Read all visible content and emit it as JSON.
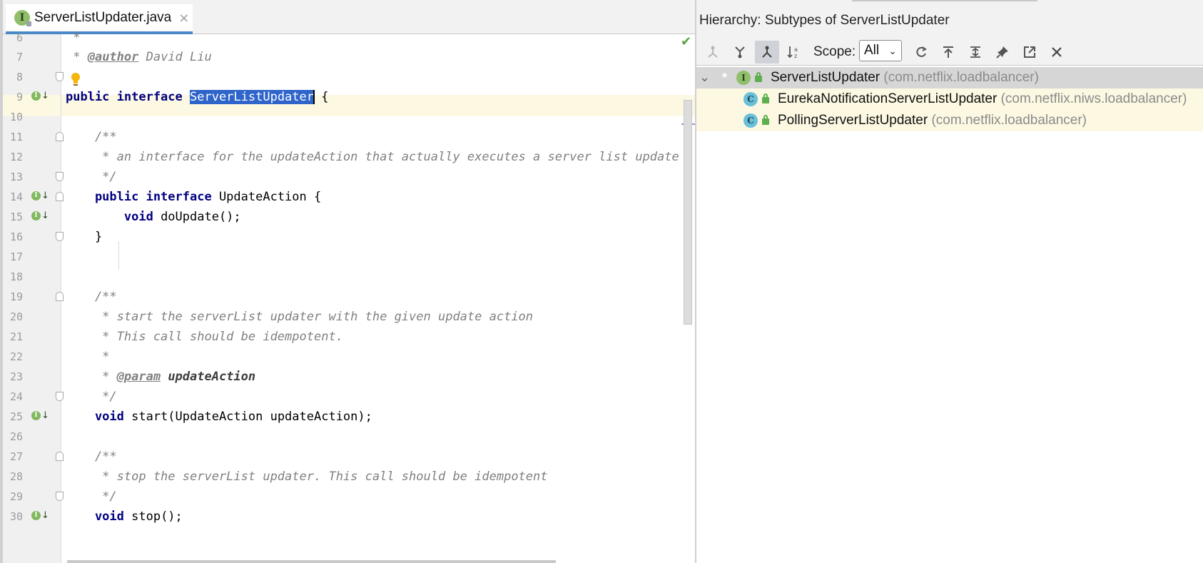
{
  "editor": {
    "tab": {
      "filename": "ServerListUpdater.java",
      "close": "×"
    },
    "lines": [
      {
        "n": "6"
      },
      {
        "n": "7"
      },
      {
        "n": "8"
      },
      {
        "n": "9"
      },
      {
        "n": "10"
      },
      {
        "n": "11"
      },
      {
        "n": "12"
      },
      {
        "n": "13"
      },
      {
        "n": "14"
      },
      {
        "n": "15"
      },
      {
        "n": "16"
      },
      {
        "n": "17"
      },
      {
        "n": "18"
      },
      {
        "n": "19"
      },
      {
        "n": "20"
      },
      {
        "n": "21"
      },
      {
        "n": "22"
      },
      {
        "n": "23"
      },
      {
        "n": "24"
      },
      {
        "n": "25"
      },
      {
        "n": "26"
      },
      {
        "n": "27"
      },
      {
        "n": "28"
      },
      {
        "n": "29"
      },
      {
        "n": "30"
      }
    ],
    "code": {
      "l6": " *",
      "l7_star": " * ",
      "l7_tag": "@author",
      "l7_text": " David Liu",
      "l9_kw": "public interface ",
      "l9_sel": "ServerListUpdater",
      "l9_rest": " {",
      "l11": "    /**",
      "l12": "     * an interface for the updateAction that actually executes a server list update",
      "l13": "     */",
      "l14_kw": "    public interface ",
      "l14_rest": "UpdateAction {",
      "l15_kw": "        void ",
      "l15_rest": "doUpdate();",
      "l16": "    }",
      "l19": "    /**",
      "l20": "     * start the serverList updater with the given update action",
      "l21": "     * This call should be idempotent.",
      "l22": "     *",
      "l23_star": "     * ",
      "l23_tag": "@param",
      "l23_param": " updateAction",
      "l24": "     */",
      "l25_kw": "    void ",
      "l25_rest": "start(UpdateAction updateAction);",
      "l27": "    /**",
      "l28": "     * stop the serverList updater. This call should be idempotent",
      "l29": "     */",
      "l30_kw": "    void ",
      "l30_rest": "stop();"
    },
    "override_icon_letter": "I"
  },
  "hierarchy": {
    "title": "Hierarchy:  Subtypes of ServerListUpdater",
    "toolbar": {
      "scope_label": "Scope:",
      "scope_value": "All",
      "buttons": [
        "supertypes-icon",
        "subtypes-icon",
        "class-hierarchy-icon",
        "sort-alpha-icon",
        "refresh-icon",
        "scroll-to-source-icon",
        "expand-all-icon",
        "pin-icon",
        "export-icon",
        "close-icon"
      ]
    },
    "tree": {
      "root": {
        "name": "ServerListUpdater",
        "package": "(com.netflix.loadbalancer)",
        "icon_letter": "I",
        "star": "*",
        "toggle": "⌄"
      },
      "children": [
        {
          "name": "EurekaNotificationServerListUpdater",
          "package": "(com.netflix.niws.loadbalancer)",
          "icon_letter": "C"
        },
        {
          "name": "PollingServerListUpdater",
          "package": "(com.netflix.loadbalancer)",
          "icon_letter": "C"
        }
      ]
    }
  },
  "colors": {
    "keyword": "#000080",
    "comment": "#808080",
    "selection": "#2f65ca",
    "current_line": "#fcf8e2",
    "interface_icon": "#8fbf6a",
    "class_icon": "#6ac0d9"
  }
}
